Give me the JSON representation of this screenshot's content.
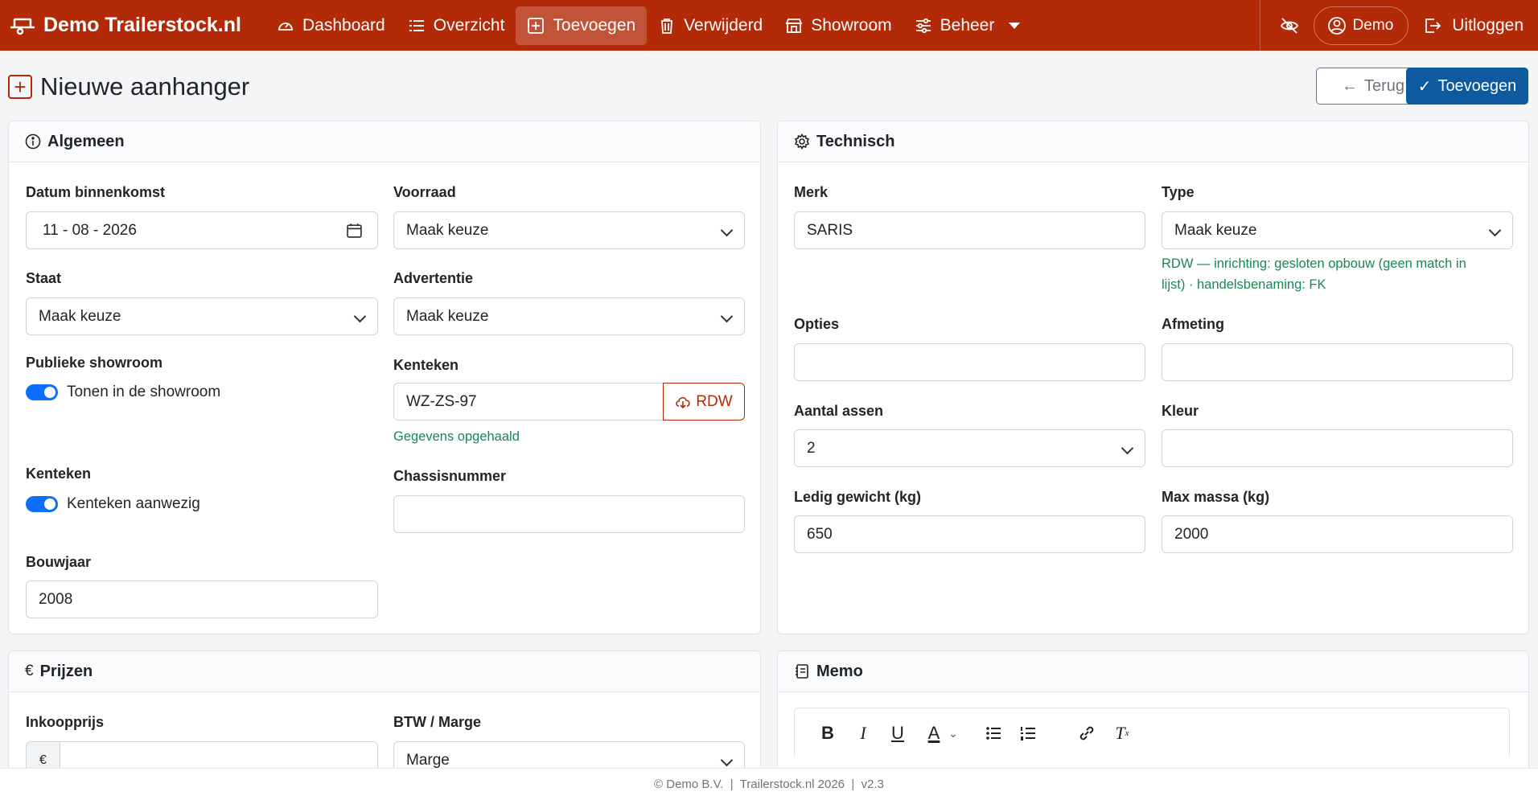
{
  "brand": "Demo Trailerstock.nl",
  "nav": [
    {
      "label": "Dashboard",
      "icon": "speedometer-icon"
    },
    {
      "label": "Overzicht",
      "icon": "list-icon"
    },
    {
      "label": "Toevoegen",
      "icon": "plus-square-icon",
      "active": true
    },
    {
      "label": "Verwijderd",
      "icon": "trash-icon"
    },
    {
      "label": "Showroom",
      "icon": "shop-icon"
    },
    {
      "label": "Beheer",
      "icon": "sliders-icon"
    }
  ],
  "user": {
    "name": "Demo",
    "logout": "Uitloggen"
  },
  "page": {
    "title": "Nieuwe aanhanger",
    "back_label": "Terug",
    "add_label": "Toevoegen"
  },
  "algemeen": {
    "title": "Algemeen",
    "datum_label": "Datum binnenkomst",
    "datum_value": "11 - 08 - 2026",
    "voorraad_label": "Voorraad",
    "voorraad_value": "Maak keuze",
    "staat_label": "Staat",
    "staat_value": "Maak keuze",
    "advertentie_label": "Advertentie",
    "advertentie_value": "Maak keuze",
    "showroom_label": "Publieke showroom",
    "showroom_switch": "Tonen in de showroom",
    "kenteken_label": "Kenteken",
    "kenteken_value": "WZ-ZS-97",
    "rdw_label": "RDW",
    "kenteken_help": "Gegevens opgehaald",
    "kenteken2_label": "Kenteken",
    "kenteken2_switch": "Kenteken aanwezig",
    "chassis_label": "Chassisnummer",
    "chassis_value": "",
    "bouwjaar_label": "Bouwjaar",
    "bouwjaar_value": "2008"
  },
  "technisch": {
    "title": "Technisch",
    "merk_label": "Merk",
    "merk_value": "SARIS",
    "type_label": "Type",
    "type_value": "Maak keuze",
    "type_help_1": "RDW — inrichting: gesloten opbouw (geen match in",
    "type_help_2": "lijst) · handelsbenaming: FK",
    "opties_label": "Opties",
    "afmeting_label": "Afmeting",
    "assen_label": "Aantal assen",
    "assen_value": "2",
    "kleur_label": "Kleur",
    "ledig_label": "Ledig gewicht (kg)",
    "ledig_value": "650",
    "max_label": "Max massa (kg)",
    "max_value": "2000"
  },
  "prijzen": {
    "title": "Prijzen",
    "inkoop_label": "Inkoopprijs",
    "currency": "€",
    "btw_label": "BTW / Marge",
    "btw_value": "Marge"
  },
  "memo": {
    "title": "Memo"
  },
  "footer": "© Demo B.V.  |  Trailerstock.nl 2026  |  v2.3",
  "colors": {
    "navbar": "#b22a07",
    "primary": "#0d5a9e",
    "switch": "#0d6efd",
    "success": "#198754"
  }
}
